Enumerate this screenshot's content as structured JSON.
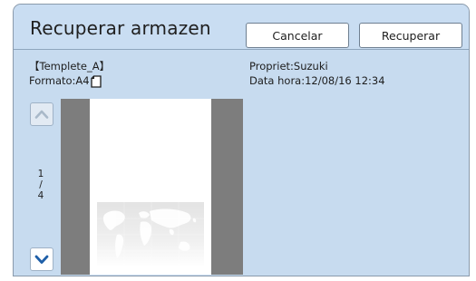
{
  "dialog": {
    "title": "Recuperar armazen",
    "cancel_label": "Cancelar",
    "recover_label": "Recuperar"
  },
  "file": {
    "name": "【Templete_A】",
    "format_label": "Formato:A4",
    "owner_label": "Propriet:Suzuki",
    "datetime_label": "Data hora:12/08/16 12:34"
  },
  "pager": {
    "current": "1",
    "separator": "/",
    "total": "4"
  },
  "icons": {
    "paper_orientation": "portrait-paper-icon",
    "up": "chevron-up-icon",
    "down": "chevron-down-icon"
  },
  "colors": {
    "panel": "#c7dbef",
    "preview_frame": "#7d7d7d",
    "nav_arrow": "#1e5fa8"
  }
}
